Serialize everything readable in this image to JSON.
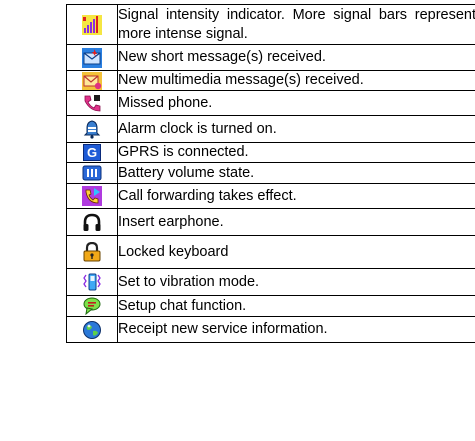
{
  "rows": [
    {
      "icon": "signal-bars-icon",
      "desc": "Signal intensity indicator. More signal bars represent more intense signal."
    },
    {
      "icon": "new-sms-icon",
      "desc": "New short message(s) received."
    },
    {
      "icon": "new-mms-icon",
      "desc": "New multimedia message(s) received."
    },
    {
      "icon": "missed-call-icon",
      "desc": "Missed phone."
    },
    {
      "icon": "alarm-clock-icon",
      "desc": "Alarm clock is turned on."
    },
    {
      "icon": "gprs-icon",
      "desc": "GPRS is connected."
    },
    {
      "icon": "battery-icon",
      "desc": "Battery volume state."
    },
    {
      "icon": "call-forwarding-icon",
      "desc": "Call forwarding takes effect."
    },
    {
      "icon": "earphone-icon",
      "desc": "Insert earphone."
    },
    {
      "icon": "keypad-lock-icon",
      "desc": "Locked keyboard"
    },
    {
      "icon": "vibration-mode-icon",
      "desc": "Set to vibration mode."
    },
    {
      "icon": "chat-icon",
      "desc": "Setup chat function."
    },
    {
      "icon": "service-info-icon",
      "desc": "Receipt new service information."
    }
  ],
  "icon_text": {
    "gprs_letter": "G"
  }
}
